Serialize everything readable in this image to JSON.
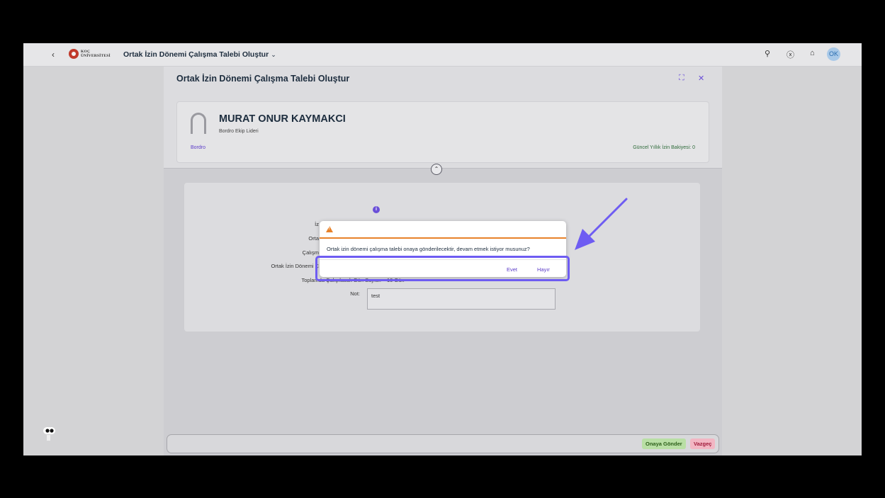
{
  "shell": {
    "logo_line1": "KOÇ",
    "logo_line2": "ÜNİVERSİTESİ",
    "app_title": "Ortak İzin Dönemi Çalışma Talebi Oluştur",
    "avatar_initials": "OK"
  },
  "page": {
    "title": "Ortak İzin Dönemi Çalışma Talebi Oluştur"
  },
  "employee": {
    "name": "MURAT ONUR KAYMAKCI",
    "role": "Bordro Ekip Lideri",
    "department": "Bordro",
    "balance": "Güncel Yıllık İzin Bakiyesi: 0"
  },
  "form": {
    "labels": [
      "İz",
      "Orta",
      "Çalışm",
      "Ortak İzin Dönemi Ç",
      "Toplamda Çalışılacak Gün Sayısı:",
      "Not:"
    ],
    "total_days_value": "10 Gün",
    "note_value": "test"
  },
  "dialog": {
    "message": "Ortak izin dönemi çalışma talebi onaya gönderilecektir, devam etmek istiyor musunuz?",
    "yes_label": "Evet",
    "no_label": "Hayır"
  },
  "footer": {
    "send_label": "Onaya Gönder",
    "cancel_label": "Vazgeç"
  },
  "colors": {
    "accent": "#6a4fd8",
    "warning": "#e8822b",
    "highlight": "#6e5cf2"
  }
}
